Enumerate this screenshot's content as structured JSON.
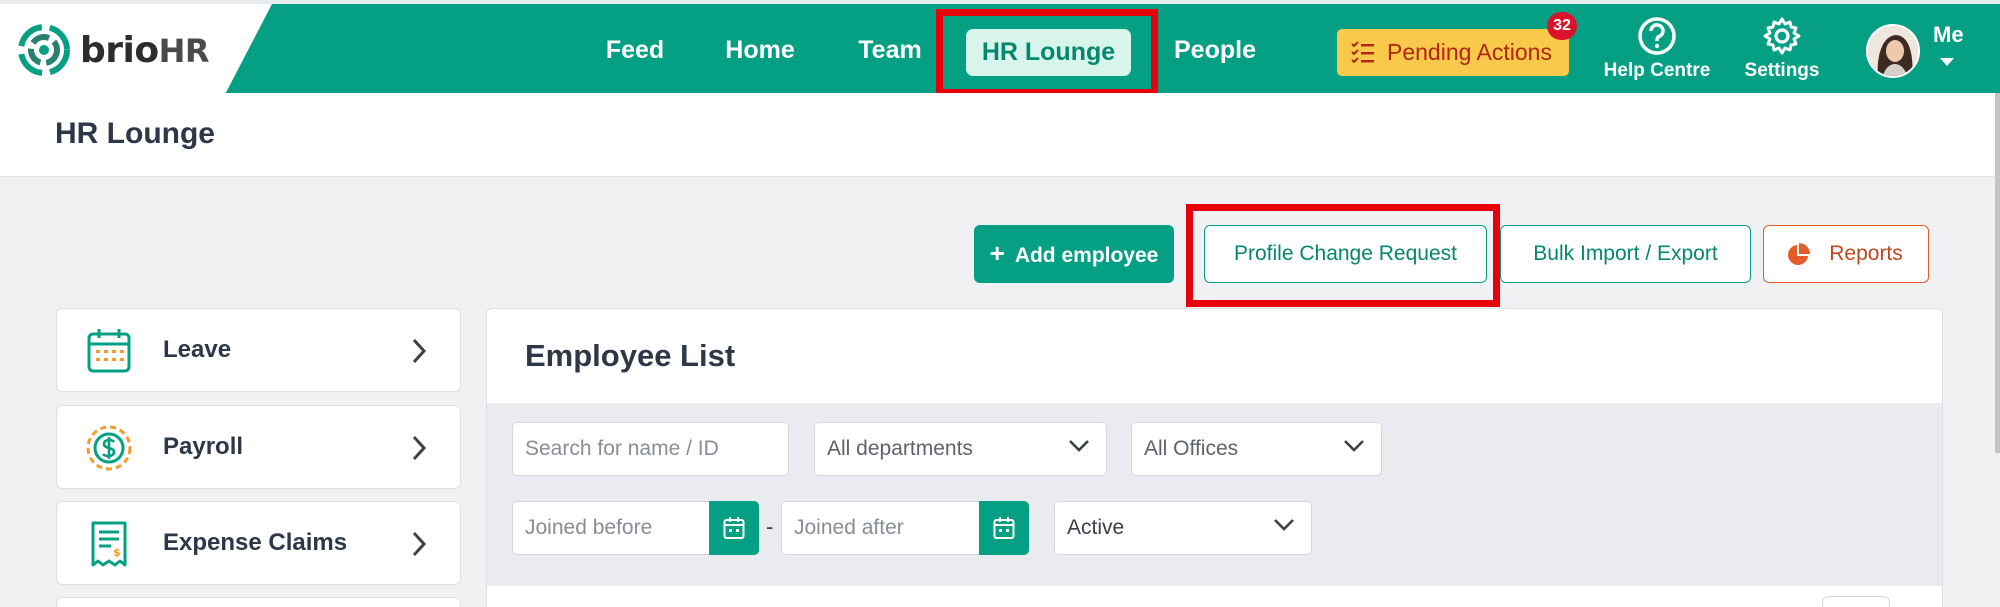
{
  "brand": {
    "name_part1": "brio",
    "name_part2": "HR",
    "colors": {
      "primary": "#05a083",
      "highlight": "#e8000b",
      "pending": "#f8c94a",
      "badge": "#d9132b",
      "reports": "#e55b2a"
    }
  },
  "nav": {
    "items": [
      {
        "label": "Feed"
      },
      {
        "label": "Home"
      },
      {
        "label": "Team"
      },
      {
        "label": "HR Lounge",
        "active": true
      },
      {
        "label": "People"
      }
    ],
    "pending": {
      "label": "Pending Actions",
      "count": "32",
      "icon": "checklist-icon"
    },
    "help": {
      "label": "Help Centre",
      "icon": "question-circle-icon"
    },
    "settings": {
      "label": "Settings",
      "icon": "gear-icon"
    },
    "user": {
      "label": "Me",
      "icon": "chevron-down-icon"
    }
  },
  "page": {
    "title": "HR Lounge"
  },
  "actions": {
    "add": "Add employee",
    "add_icon_text": "+",
    "profile_change": "Profile Change Request",
    "bulk": "Bulk Import / Export",
    "reports": "Reports"
  },
  "menu": [
    {
      "label": "Leave",
      "icon": "calendar-icon"
    },
    {
      "label": "Payroll",
      "icon": "dollar-coin-icon"
    },
    {
      "label": "Expense Claims",
      "icon": "receipt-icon"
    }
  ],
  "employee_list": {
    "title": "Employee List",
    "filters": {
      "search_placeholder": "Search for name / ID",
      "department": "All departments",
      "office": "All Offices",
      "joined_before_placeholder": "Joined before",
      "joined_after_placeholder": "Joined after",
      "separator": "-",
      "status": "Active"
    }
  }
}
